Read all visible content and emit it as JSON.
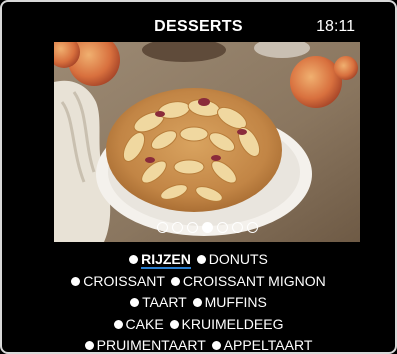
{
  "header": {
    "title": "DESSERTS",
    "time": "18:11"
  },
  "carousel": {
    "image_alt": "",
    "total_slides": 7,
    "active_index": 3
  },
  "menu": {
    "rows": [
      [
        {
          "label": "RIJZEN",
          "selected": true
        },
        {
          "label": "DONUTS",
          "selected": false
        }
      ],
      [
        {
          "label": "CROISSANT",
          "selected": false
        },
        {
          "label": "CROISSANT MIGNON",
          "selected": false
        }
      ],
      [
        {
          "label": "TAART",
          "selected": false
        },
        {
          "label": "MUFFINS",
          "selected": false
        }
      ],
      [
        {
          "label": "CAKE",
          "selected": false
        },
        {
          "label": "KRUIMELDEEG",
          "selected": false
        }
      ],
      [
        {
          "label": "PRUIMENTAART",
          "selected": false
        },
        {
          "label": "APPELTAART",
          "selected": false
        }
      ]
    ]
  },
  "colors": {
    "background": "#000000",
    "text": "#ffffff",
    "selected_underline": "#2a7fd0",
    "frame_border": "#d9d9d9"
  }
}
